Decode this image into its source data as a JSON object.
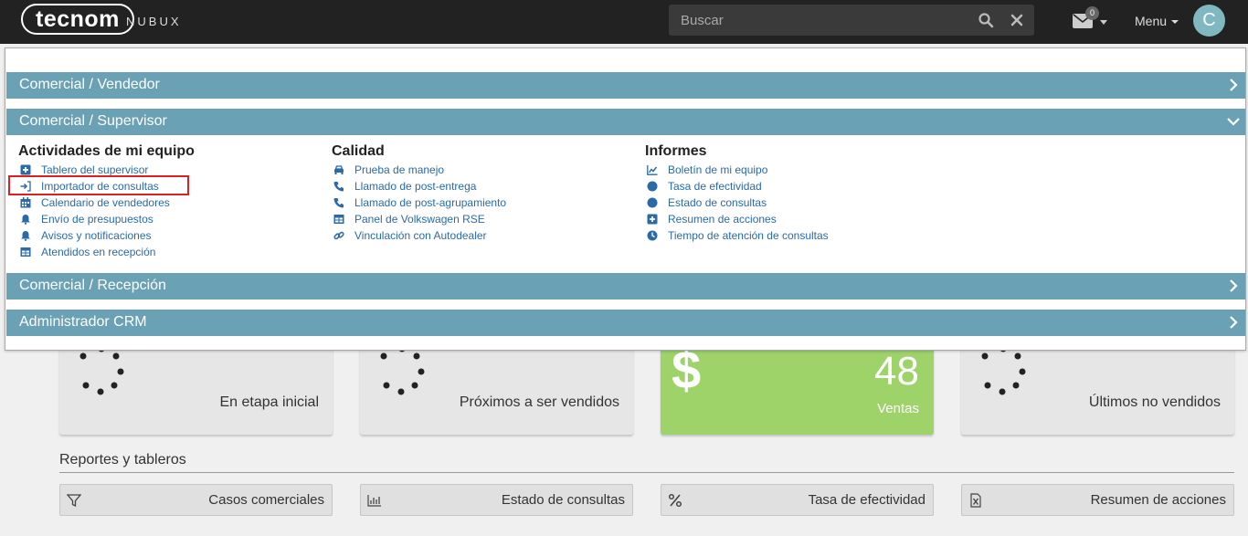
{
  "header": {
    "logo": "tecnom",
    "logo_sub": "NUBUX",
    "search_placeholder": "Buscar",
    "mail_badge": "0",
    "menu_label": "Menu",
    "avatar_letter": "C"
  },
  "accordion": {
    "vendedor": "Comercial / Vendedor",
    "supervisor": "Comercial / Supervisor",
    "recepcion": "Comercial / Recepción",
    "crm": "Administrador CRM"
  },
  "supervisor": {
    "col1": {
      "title": "Actividades de mi equipo",
      "items": [
        {
          "label": "Tablero del supervisor",
          "icon": "plus-square-icon"
        },
        {
          "label": "Importador de consultas",
          "icon": "sign-in-icon"
        },
        {
          "label": "Calendario de vendedores",
          "icon": "calendar-icon"
        },
        {
          "label": "Envío de presupuestos",
          "icon": "bell-icon"
        },
        {
          "label": "Avisos y notificaciones",
          "icon": "bell-icon"
        },
        {
          "label": "Atendidos en recepción",
          "icon": "table-icon"
        }
      ]
    },
    "col2": {
      "title": "Calidad",
      "items": [
        {
          "label": "Prueba de manejo",
          "icon": "car-icon"
        },
        {
          "label": "Llamado de post-entrega",
          "icon": "phone-icon"
        },
        {
          "label": "Llamado de post-agrupamiento",
          "icon": "phone-icon"
        },
        {
          "label": "Panel de Volkswagen RSE",
          "icon": "table-icon"
        },
        {
          "label": "Vinculación con Autodealer",
          "icon": "link-icon"
        }
      ]
    },
    "col3": {
      "title": "Informes",
      "items": [
        {
          "label": "Boletín de mi equipo",
          "icon": "line-chart-icon"
        },
        {
          "label": "Tasa de efectividad",
          "icon": "circle-icon"
        },
        {
          "label": "Estado de consultas",
          "icon": "circle-icon"
        },
        {
          "label": "Resumen de acciones",
          "icon": "plus-square-icon"
        },
        {
          "label": "Tiempo de atención de consultas",
          "icon": "clock-icon"
        }
      ]
    }
  },
  "cards": [
    {
      "label": "En etapa inicial"
    },
    {
      "label": "Próximos a ser vendidos"
    },
    {
      "label": "Ventas",
      "value": "48",
      "icon": "dollar-icon"
    },
    {
      "label": "Últimos no vendidos"
    }
  ],
  "reports": {
    "title": "Reportes y tableros",
    "buttons": [
      {
        "label": "Casos comerciales",
        "icon": "filter-icon"
      },
      {
        "label": "Estado de consultas",
        "icon": "bar-chart-icon"
      },
      {
        "label": "Tasa de efectividad",
        "icon": "percent-icon"
      },
      {
        "label": "Resumen de acciones",
        "icon": "excel-file-icon"
      }
    ]
  },
  "colors": {
    "topbar": "#222222",
    "accordion": "#6ba1b5",
    "link": "#2a6aa8",
    "ventas_card": "#9ed36a",
    "highlight": "#e02020"
  }
}
